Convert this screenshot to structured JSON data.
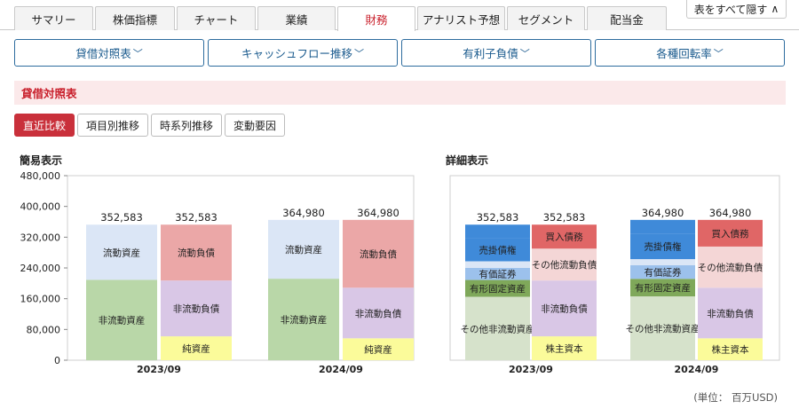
{
  "tabs": [
    {
      "label": "サマリー",
      "active": false
    },
    {
      "label": "株価指標",
      "active": false
    },
    {
      "label": "チャート",
      "active": false
    },
    {
      "label": "業績",
      "active": false
    },
    {
      "label": "財務",
      "active": true
    },
    {
      "label": "アナリスト予想",
      "active": false
    },
    {
      "label": "セグメント",
      "active": false
    },
    {
      "label": "配当金",
      "active": false
    }
  ],
  "hide_all_label": "表をすべて隠す",
  "segments": [
    {
      "label": "貸借対照表",
      "chevron": "﹀"
    },
    {
      "label": "キャッシュフロー推移",
      "chevron": "﹀"
    },
    {
      "label": "有利子負債",
      "chevron": "﹀"
    },
    {
      "label": "各種回転率",
      "chevron": "﹀"
    }
  ],
  "section_title": "貸借対照表",
  "view_buttons": [
    {
      "label": "直近比較",
      "active": true
    },
    {
      "label": "項目別推移",
      "active": false
    },
    {
      "label": "時系列推移",
      "active": false
    },
    {
      "label": "変動要因",
      "active": false
    }
  ],
  "colors": {
    "active_tab": "#c9202c",
    "segment_border": "#2d6c9e",
    "current_assets": "#dbe6f6",
    "noncurrent_assets": "#b9d7a8",
    "current_liabilities": "#eba7a7",
    "noncurrent_liabilities": "#d9c7e6",
    "net_assets": "#fbfb9a",
    "receivables": "#3f8ad9",
    "securities": "#9cc1ec",
    "ppe": "#7fa85a",
    "other_noncurrent_assets": "#d6e2cb",
    "payables": "#e06666",
    "other_current_liabilities": "#f4d6d6",
    "shareholders_equity": "#fbfb9a"
  },
  "unit_label": "(単位： 百万USD)",
  "chart_data": [
    {
      "type": "stacked-bar",
      "title": "簡易表示",
      "ylim": [
        0,
        480000
      ],
      "yticks": [
        "0",
        "80,000",
        "160,000",
        "240,000",
        "320,000",
        "400,000",
        "480,000"
      ],
      "yticks_values": [
        0,
        80000,
        160000,
        240000,
        320000,
        400000,
        480000
      ],
      "categories": [
        "2023/09",
        "2024/09"
      ],
      "grid": false,
      "groups": [
        {
          "category": "2023/09",
          "bars": [
            {
              "total": 352583,
              "total_label": "352,583",
              "segments": [
                {
                  "name": "非流動資産",
                  "value": 209017,
                  "color_key": "noncurrent_assets"
                },
                {
                  "name": "流動資産",
                  "value": 143566,
                  "color_key": "current_assets"
                }
              ]
            },
            {
              "total": 352583,
              "total_label": "352,583",
              "segments": [
                {
                  "name": "純資産",
                  "value": 62146,
                  "color_key": "net_assets"
                },
                {
                  "name": "非流動負債",
                  "value": 145129,
                  "color_key": "noncurrent_liabilities"
                },
                {
                  "name": "流動負債",
                  "value": 145308,
                  "color_key": "current_liabilities"
                }
              ]
            }
          ]
        },
        {
          "category": "2024/09",
          "bars": [
            {
              "total": 364980,
              "total_label": "364,980",
              "segments": [
                {
                  "name": "非流動資産",
                  "value": 211993,
                  "color_key": "noncurrent_assets"
                },
                {
                  "name": "流動資産",
                  "value": 152987,
                  "color_key": "current_assets"
                }
              ]
            },
            {
              "total": 364980,
              "total_label": "364,980",
              "segments": [
                {
                  "name": "純資産",
                  "value": 56950,
                  "color_key": "net_assets"
                },
                {
                  "name": "非流動負債",
                  "value": 131638,
                  "color_key": "noncurrent_liabilities"
                },
                {
                  "name": "流動負債",
                  "value": 176392,
                  "color_key": "current_liabilities"
                }
              ]
            }
          ]
        }
      ]
    },
    {
      "type": "stacked-bar",
      "title": "詳細表示",
      "ylim": [
        0,
        480000
      ],
      "categories": [
        "2023/09",
        "2024/09"
      ],
      "grid": false,
      "groups": [
        {
          "category": "2023/09",
          "bars": [
            {
              "total": 352583,
              "total_label": "352,583",
              "segments": [
                {
                  "name": "その他非流動資産",
                  "value": 165000,
                  "color_key": "other_noncurrent_assets"
                },
                {
                  "name": "有形固定資産",
                  "value": 43715,
                  "color_key": "ppe"
                },
                {
                  "name": "有価証券",
                  "value": 31590,
                  "color_key": "securities"
                },
                {
                  "name": "",
                  "value": 17000,
                  "color_key": "current_assets"
                },
                {
                  "name": "売掛債権",
                  "value": 60985,
                  "color_key": "receivables"
                },
                {
                  "name": "",
                  "value": 34293,
                  "color_key": "receivables"
                }
              ]
            },
            {
              "total": 352583,
              "total_label": "352,583",
              "segments": [
                {
                  "name": "株主資本",
                  "value": 62146,
                  "color_key": "shareholders_equity"
                },
                {
                  "name": "非流動負債",
                  "value": 145129,
                  "color_key": "noncurrent_liabilities"
                },
                {
                  "name": "その他流動負債",
                  "value": 83000,
                  "color_key": "other_current_liabilities"
                },
                {
                  "name": "買入債務",
                  "value": 62308,
                  "color_key": "payables"
                }
              ]
            }
          ]
        },
        {
          "category": "2024/09",
          "bars": [
            {
              "total": 364980,
              "total_label": "364,980",
              "segments": [
                {
                  "name": "その他非流動資産",
                  "value": 166000,
                  "color_key": "other_noncurrent_assets"
                },
                {
                  "name": "有形固定資産",
                  "value": 45680,
                  "color_key": "ppe"
                },
                {
                  "name": "有価証券",
                  "value": 35228,
                  "color_key": "securities"
                },
                {
                  "name": "",
                  "value": 16000,
                  "color_key": "current_assets"
                },
                {
                  "name": "売掛債権",
                  "value": 66243,
                  "color_key": "receivables"
                },
                {
                  "name": "",
                  "value": 35829,
                  "color_key": "receivables"
                }
              ]
            },
            {
              "total": 364980,
              "total_label": "364,980",
              "segments": [
                {
                  "name": "株主資本",
                  "value": 56950,
                  "color_key": "shareholders_equity"
                },
                {
                  "name": "非流動負債",
                  "value": 131638,
                  "color_key": "noncurrent_liabilities"
                },
                {
                  "name": "その他流動負債",
                  "value": 107000,
                  "color_key": "other_current_liabilities"
                },
                {
                  "name": "買入債務",
                  "value": 69392,
                  "color_key": "payables"
                }
              ]
            }
          ]
        }
      ]
    }
  ]
}
